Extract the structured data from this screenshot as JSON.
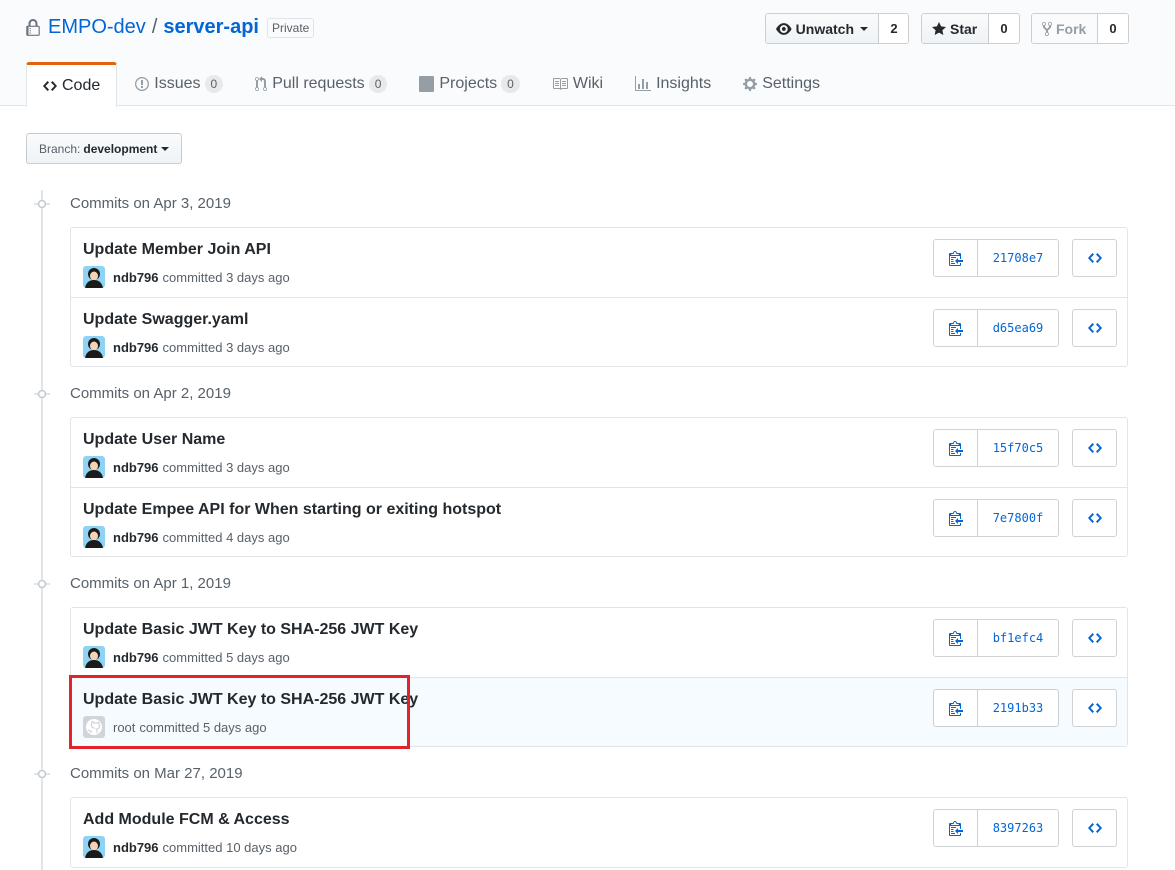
{
  "repo": {
    "owner": "EMPO-dev",
    "separator": "/",
    "name": "server-api",
    "visibility": "Private"
  },
  "actions": {
    "watch": {
      "label": "Unwatch",
      "count": "2"
    },
    "star": {
      "label": "Star",
      "count": "0"
    },
    "fork": {
      "label": "Fork",
      "count": "0"
    }
  },
  "tabs": [
    {
      "label": "Code",
      "icon": "code-icon",
      "selected": true
    },
    {
      "label": "Issues",
      "icon": "issue-icon",
      "count": "0"
    },
    {
      "label": "Pull requests",
      "icon": "pull-request-icon",
      "count": "0"
    },
    {
      "label": "Projects",
      "icon": "project-icon",
      "count": "0"
    },
    {
      "label": "Wiki",
      "icon": "book-icon"
    },
    {
      "label": "Insights",
      "icon": "graph-icon"
    },
    {
      "label": "Settings",
      "icon": "gear-icon"
    }
  ],
  "branch": {
    "label": "Branch:",
    "value": "development"
  },
  "groups": [
    {
      "heading": "Commits on Apr 3, 2019",
      "commits": [
        {
          "title": "Update Member Join API",
          "author": "ndb796",
          "committed": "committed 3 days ago",
          "sha": "21708e7"
        },
        {
          "title": "Update Swagger.yaml",
          "author": "ndb796",
          "committed": "committed 3 days ago",
          "sha": "d65ea69"
        }
      ]
    },
    {
      "heading": "Commits on Apr 2, 2019",
      "commits": [
        {
          "title": "Update User Name",
          "author": "ndb796",
          "committed": "committed 3 days ago",
          "sha": "15f70c5"
        },
        {
          "title": "Update Empee API for When starting or exiting hotspot",
          "author": "ndb796",
          "committed": "committed 4 days ago",
          "sha": "7e7800f"
        }
      ]
    },
    {
      "heading": "Commits on Apr 1, 2019",
      "commits": [
        {
          "title": "Update Basic JWT Key to SHA-256 JWT Key",
          "author": "ndb796",
          "committed": "committed 5 days ago",
          "sha": "bf1efc4"
        },
        {
          "title": "Update Basic JWT Key to SHA-256 JWT Key",
          "author": "root",
          "committed": "committed 5 days ago",
          "sha": "2191b33",
          "highlighted": true
        }
      ]
    },
    {
      "heading": "Commits on Mar 27, 2019",
      "commits": [
        {
          "title": "Add Module FCM & Access",
          "author": "ndb796",
          "committed": "committed 10 days ago",
          "sha": "8397263"
        }
      ]
    }
  ],
  "colors": {
    "link": "#0366d6",
    "tab_accent": "#e36209",
    "highlight_border": "#e3232c"
  }
}
